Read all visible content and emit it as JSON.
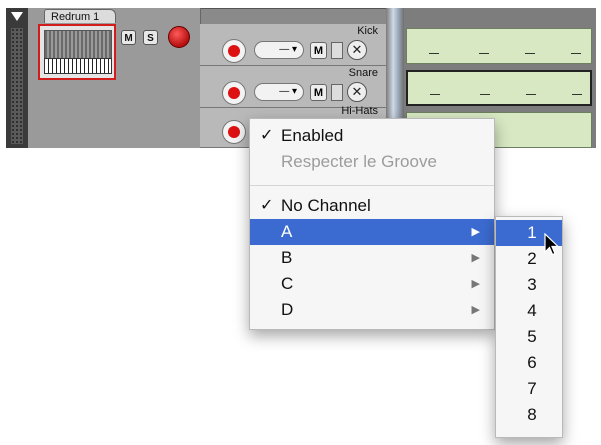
{
  "device": {
    "name": "Redrum 1",
    "mute_label": "M",
    "solo_label": "S",
    "record_icon": "record-icon"
  },
  "lanes": [
    {
      "name": "Kick",
      "selector": "—",
      "mute_label": "M",
      "close_glyph": "✕"
    },
    {
      "name": "Snare",
      "selector": "—",
      "mute_label": "M",
      "close_glyph": "✕"
    },
    {
      "name": "Hi-Hats",
      "selector": "",
      "mute_label": "",
      "close_glyph": ""
    }
  ],
  "context_menu": {
    "items": [
      {
        "label": "Enabled",
        "checked": true,
        "enabled": true
      },
      {
        "label": "Respecter le Groove",
        "checked": false,
        "enabled": false
      },
      {
        "label": "No Channel",
        "checked": true,
        "enabled": true
      },
      {
        "label": "A",
        "submenu": true,
        "highlighted": true
      },
      {
        "label": "B",
        "submenu": true
      },
      {
        "label": "C",
        "submenu": true
      },
      {
        "label": "D",
        "submenu": true
      }
    ],
    "check_glyph": "✓",
    "submenu_arrow": "▶"
  },
  "submenu": {
    "items": [
      "1",
      "2",
      "3",
      "4",
      "5",
      "6",
      "7",
      "8"
    ],
    "highlighted_index": 0
  },
  "colors": {
    "highlight": "#3b6bd0",
    "record_red": "#d11111",
    "clip_green": "#d7e8c3",
    "device_border": "#d21d1d"
  }
}
